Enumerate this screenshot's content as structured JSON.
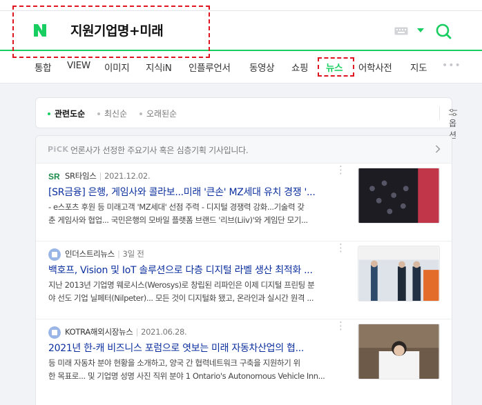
{
  "search": {
    "query": "지원기업명+미래"
  },
  "tabs": [
    {
      "label": "통합"
    },
    {
      "label": "VIEW"
    },
    {
      "label": "이미지"
    },
    {
      "label": "지식iN"
    },
    {
      "label": "인플루언서"
    },
    {
      "label": "동영상"
    },
    {
      "label": "쇼핑"
    },
    {
      "label": "뉴스",
      "active": true
    },
    {
      "label": "어학사전"
    },
    {
      "label": "지도"
    },
    {
      "label": "•••"
    }
  ],
  "sort": {
    "options": [
      "관련도순",
      "최신순",
      "오래된순"
    ],
    "selected": "관련도순",
    "option_button": "옵션"
  },
  "pick": {
    "badge": "PiCK",
    "text": "언론사가 선정한 주요기사 혹은 심층기획 기사입니다."
  },
  "news": [
    {
      "press": "SR타임스",
      "date": "2021.12.02.",
      "title": "[SR금융] 은행, 게임사와 콜라보...미래 '큰손' MZ세대 유치 경쟁 '...",
      "desc_line1": "- e스포츠 후원 등 미래고객 'MZ세대' 선점 주력 - 디지털 경쟁력 강화...기술력 갖",
      "desc_line2": "춘 게임사와 협업... 국민은행의 모바일 플랫폼 브랜드 '리브(Liiv)'와 게임단 모기..."
    },
    {
      "press": "인더스트리뉴스",
      "date": "3일 전",
      "title": "백호프, Vision 및 IoT 솔루션으로 다층 디지털 라벨 생산 최적화 ...",
      "desc_line1": "지난 2013년 기업명 웨로시스(Werosys)로 창립된 리파인은 이제 디지털 프린팅 분",
      "desc_line2": "야 선도 기업 닐페터(Nilpeter)... 모든 것이 디지털화 됐고, 온라인과 실시간 원격 ..."
    },
    {
      "press": "KOTRA해외시장뉴스",
      "date": "2021.06.28.",
      "title": "2021년 한-캐 비즈니스 포럼으로 엿보는 미래 자동차산업의 협...",
      "desc_line1": "등 미래 자동차 분야 현황을 소개하고, 양국 간 협력네트워크 구축을 지원하기 위",
      "desc_line2": "한 목표로... 및 기업명 성명 사진 직위 분야 1 Ontario's Autonomous Vehicle Inn..."
    }
  ],
  "colors": {
    "brand_green": "#19ce60",
    "highlight_red": "#e0141e",
    "title_blue": "#0b2f9f"
  }
}
